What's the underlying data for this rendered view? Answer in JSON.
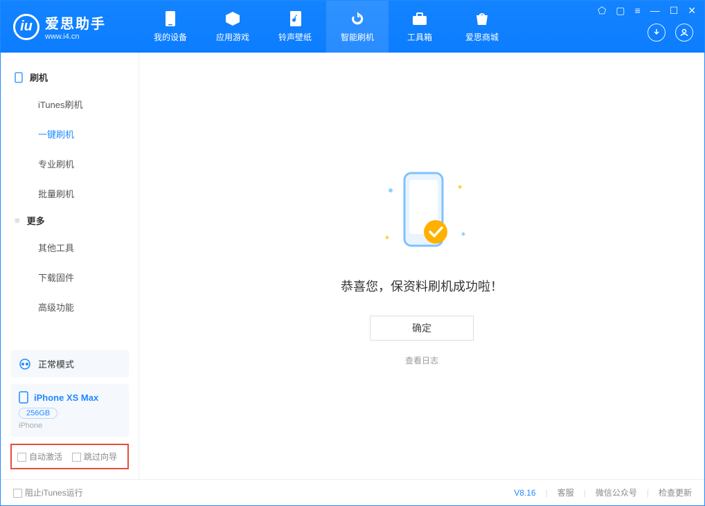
{
  "app": {
    "name_cn": "爱思助手",
    "name_en": "www.i4.cn"
  },
  "nav": [
    {
      "label": "我的设备"
    },
    {
      "label": "应用游戏"
    },
    {
      "label": "铃声壁纸"
    },
    {
      "label": "智能刷机",
      "active": true
    },
    {
      "label": "工具箱"
    },
    {
      "label": "爱思商城"
    }
  ],
  "sidebar": {
    "section_flash": "刷机",
    "items_flash": [
      "iTunes刷机",
      "一键刷机",
      "专业刷机",
      "批量刷机"
    ],
    "active_flash_index": 1,
    "section_more": "更多",
    "items_more": [
      "其他工具",
      "下载固件",
      "高级功能"
    ],
    "mode": "正常模式",
    "device": {
      "name": "iPhone XS Max",
      "capacity": "256GB",
      "type": "iPhone"
    },
    "opt_activate": "自动激活",
    "opt_skip": "跳过向导"
  },
  "main": {
    "success": "恭喜您，保资料刷机成功啦！",
    "ok": "确定",
    "view_log": "查看日志"
  },
  "status": {
    "block_itunes": "阻止iTunes运行",
    "version": "V8.16",
    "support": "客服",
    "wechat": "微信公众号",
    "update": "检查更新"
  }
}
